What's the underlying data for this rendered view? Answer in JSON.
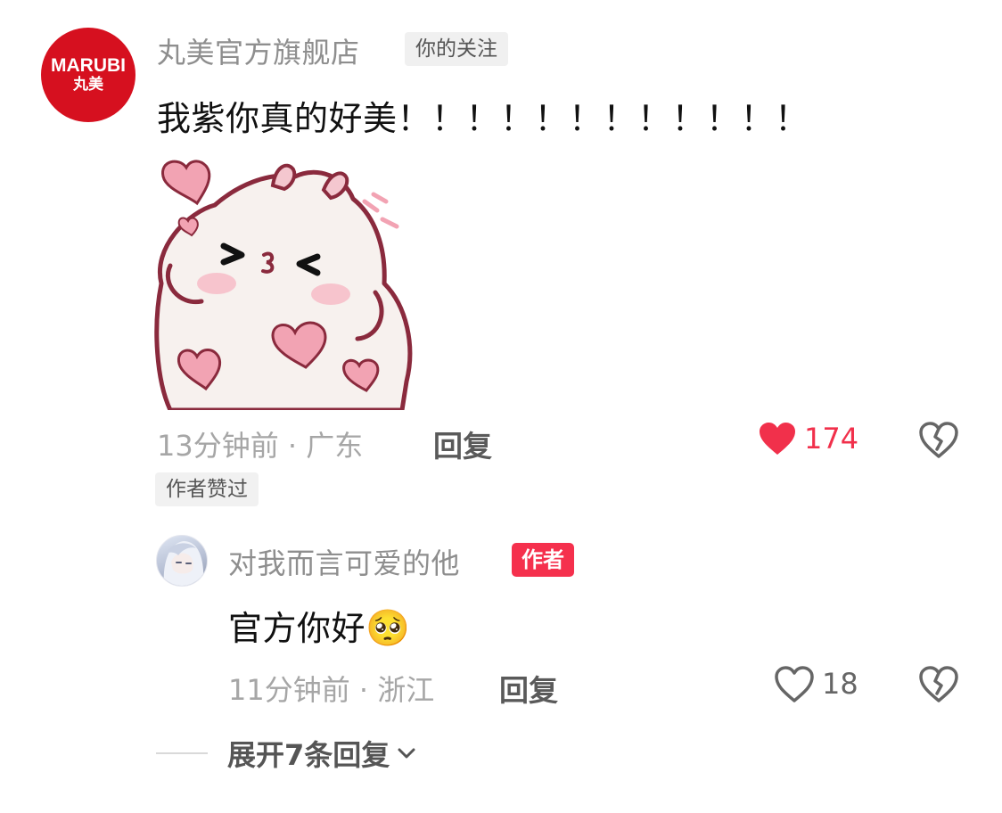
{
  "comment": {
    "avatar": {
      "text_en": "MARUBI",
      "text_zh": "丸美",
      "color": "#d6101f"
    },
    "username": "丸美官方旗舰店",
    "follow_tag": "你的关注",
    "text": "我紫你真的好美！！！！！！！！！！！！",
    "sticker_icon": "hamster-heart-sticker",
    "meta": "13分钟前 · 广东",
    "reply_label": "回复",
    "like_count": "174",
    "liked": true,
    "liked_color": "#f1304b",
    "author_liked_tag": "作者赞过"
  },
  "reply": {
    "username": "对我而言可爱的他",
    "author_tag": "作者",
    "author_tag_color": "#f5304d",
    "text": "官方你好",
    "emoji": "🥺",
    "meta": "11分钟前 · 浙江",
    "reply_label": "回复",
    "like_count": "18",
    "liked": false
  },
  "expand": {
    "label": "展开7条回复"
  }
}
